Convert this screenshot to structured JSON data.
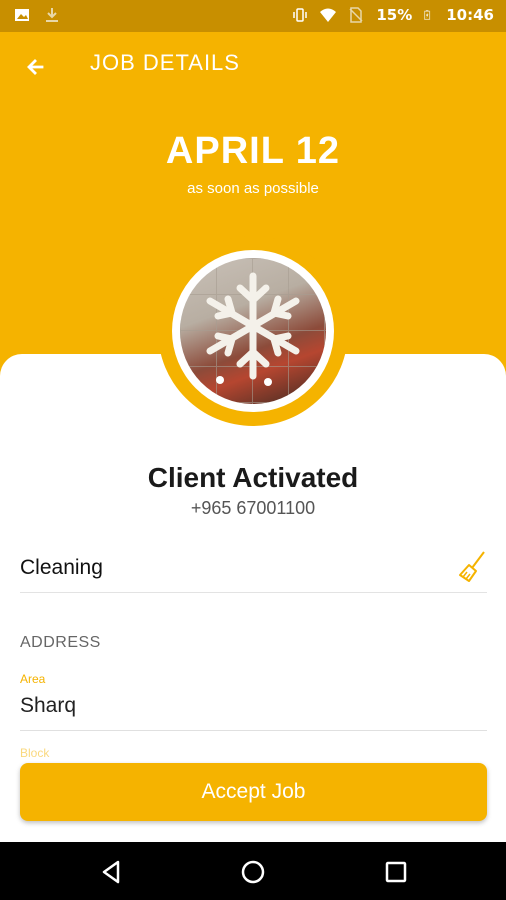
{
  "status_bar": {
    "battery_percent": "15%",
    "time": "10:46",
    "icons": [
      "image-icon",
      "download-icon",
      "vibrate-icon",
      "wifi-icon",
      "no-sim-icon",
      "battery-charging-icon"
    ]
  },
  "header": {
    "title": "JOB DETAILS",
    "back_icon": "arrow-left-icon"
  },
  "job": {
    "date": "APRIL 12",
    "time_note": "as soon as possible"
  },
  "client": {
    "name": "Client Activated",
    "phone": "+965 67001100",
    "avatar": "snowflake-photo"
  },
  "service": {
    "label": "Cleaning",
    "icon": "broom-icon"
  },
  "address": {
    "heading": "ADDRESS",
    "area_label": "Area",
    "area_value": "Sharq",
    "next_label": "Block"
  },
  "actions": {
    "accept_label": "Accept Job"
  },
  "navigation": {
    "icons": [
      "back-triangle-icon",
      "home-circle-icon",
      "recents-square-icon"
    ]
  },
  "colors": {
    "accent": "#f5b300",
    "status_bar": "#c88f00",
    "navbar": "#000000"
  }
}
